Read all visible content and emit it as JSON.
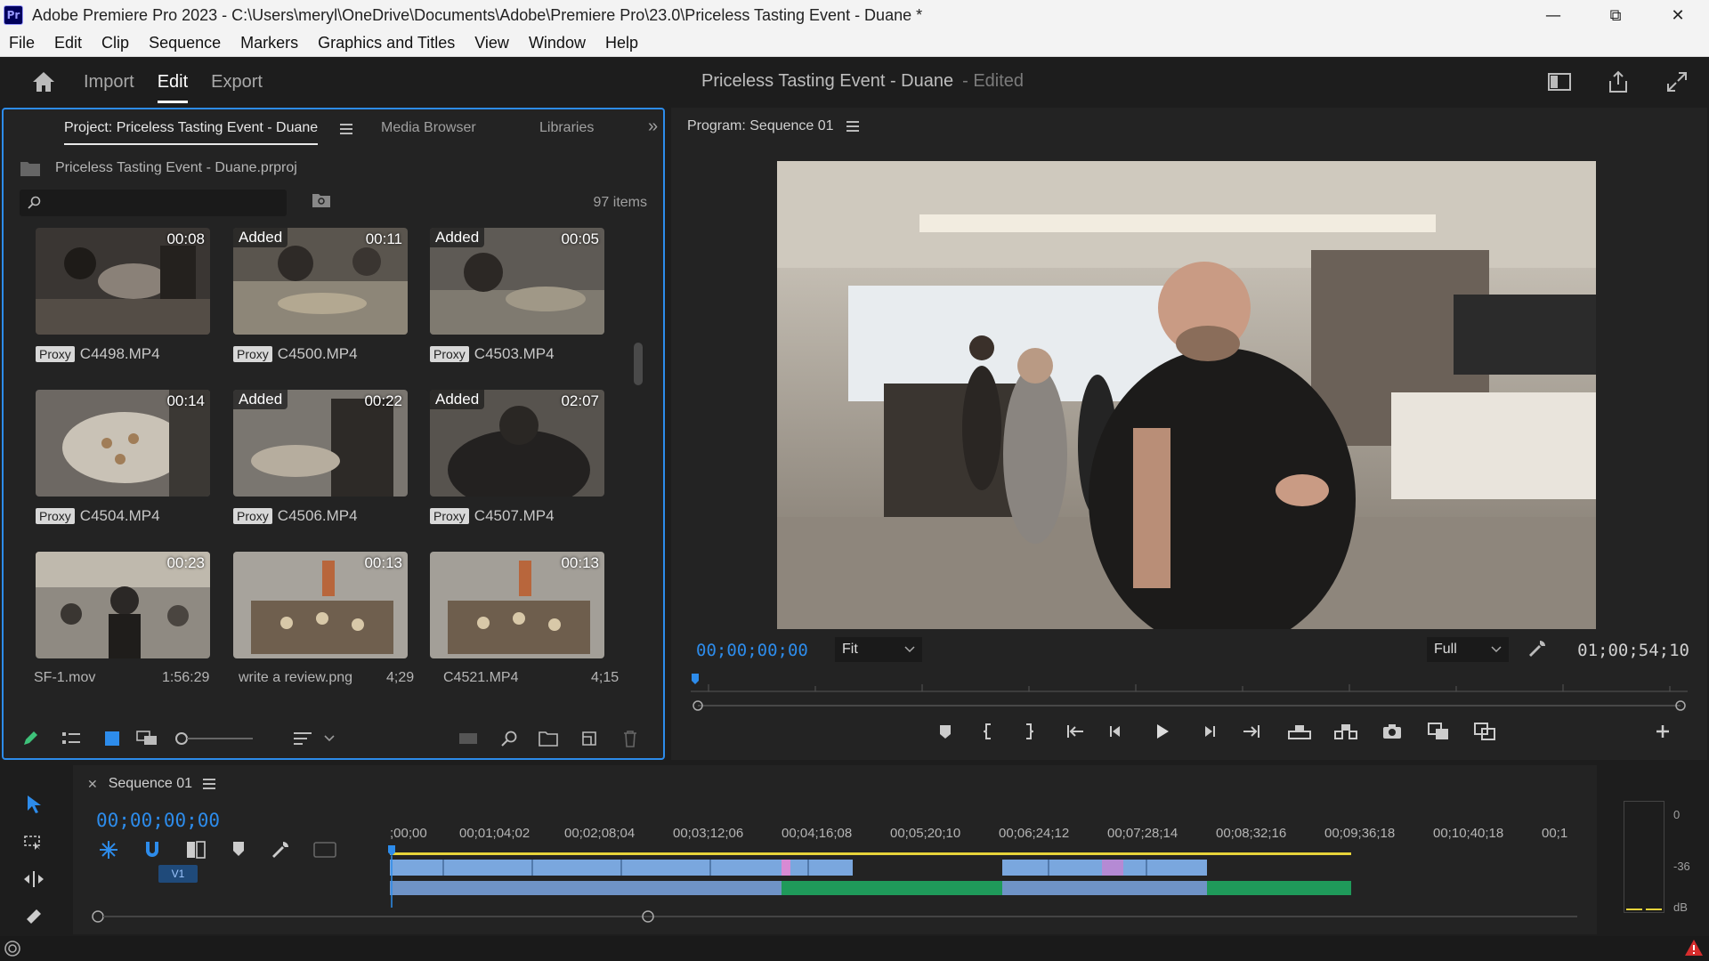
{
  "window": {
    "title": "Adobe Premiere Pro 2023 - C:\\Users\\meryl\\OneDrive\\Documents\\Adobe\\Premiere Pro\\23.0\\Priceless Tasting Event - Duane *",
    "app_icon": "Pr"
  },
  "menu": [
    "File",
    "Edit",
    "Clip",
    "Sequence",
    "Markers",
    "Graphics and Titles",
    "View",
    "Window",
    "Help"
  ],
  "header": {
    "tabs": [
      "Import",
      "Edit",
      "Export"
    ],
    "active_tab": "Edit",
    "project_title": "Priceless Tasting Event - Duane",
    "edited_label": "- Edited"
  },
  "project_panel": {
    "tabs": [
      "Project: Priceless Tasting Event - Duane",
      "Media Browser",
      "Libraries"
    ],
    "file_name": "Priceless Tasting Event - Duane.prproj",
    "search_placeholder": "",
    "items_count": "97 items",
    "clips": [
      {
        "name": "C4498.MP4",
        "duration": "00:08",
        "badge": "",
        "proxy": "Proxy"
      },
      {
        "name": "C4500.MP4",
        "duration": "00:11",
        "badge": "Added",
        "proxy": "Proxy"
      },
      {
        "name": "C4503.MP4",
        "duration": "00:05",
        "badge": "Added",
        "proxy": "Proxy"
      },
      {
        "name": "C4504.MP4",
        "duration": "00:14",
        "badge": "",
        "proxy": "Proxy"
      },
      {
        "name": "C4506.MP4",
        "duration": "00:22",
        "badge": "Added",
        "proxy": "Proxy"
      },
      {
        "name": "C4507.MP4",
        "duration": "02:07",
        "badge": "Added",
        "proxy": "Proxy"
      },
      {
        "name": "SF-1.mov",
        "duration": "00:23",
        "badge": "",
        "proxy": ""
      },
      {
        "name": "write a review.png",
        "duration": "00:13",
        "badge": "",
        "proxy": ""
      },
      {
        "name": "C4521.MP4",
        "duration": "00:13",
        "badge": "",
        "proxy": ""
      }
    ],
    "bottom_row": [
      {
        "name": "SF-1.mov",
        "length": "1:56:29"
      },
      {
        "name": "write a review.png",
        "length": "4;29"
      },
      {
        "name": "C4521.MP4",
        "length": "4;15"
      }
    ]
  },
  "program_monitor": {
    "title": "Program: Sequence 01",
    "current_timecode": "00;00;00;00",
    "fit": "Fit",
    "resolution": "Full",
    "duration_timecode": "01;00;54;10"
  },
  "timeline": {
    "sequence_tab": "Sequence 01",
    "timecode": "00;00;00;00",
    "ruler": [
      ";00;00",
      "00;01;04;02",
      "00;02;08;04",
      "00;03;12;06",
      "00;04;16;08",
      "00;05;20;10",
      "00;06;24;12",
      "00;07;28;14",
      "00;08;32;16",
      "00;09;36;18",
      "00;10;40;18",
      "00;1"
    ],
    "track_label": "V1"
  },
  "meters": {
    "top": "0",
    "mid": "-36",
    "unit": "dB"
  },
  "colors": {
    "accent": "#2d8ceb",
    "video_clip": "#7aa7de",
    "audio_clip": "#1f9a5a",
    "selection_border": "#2d8ceb"
  }
}
